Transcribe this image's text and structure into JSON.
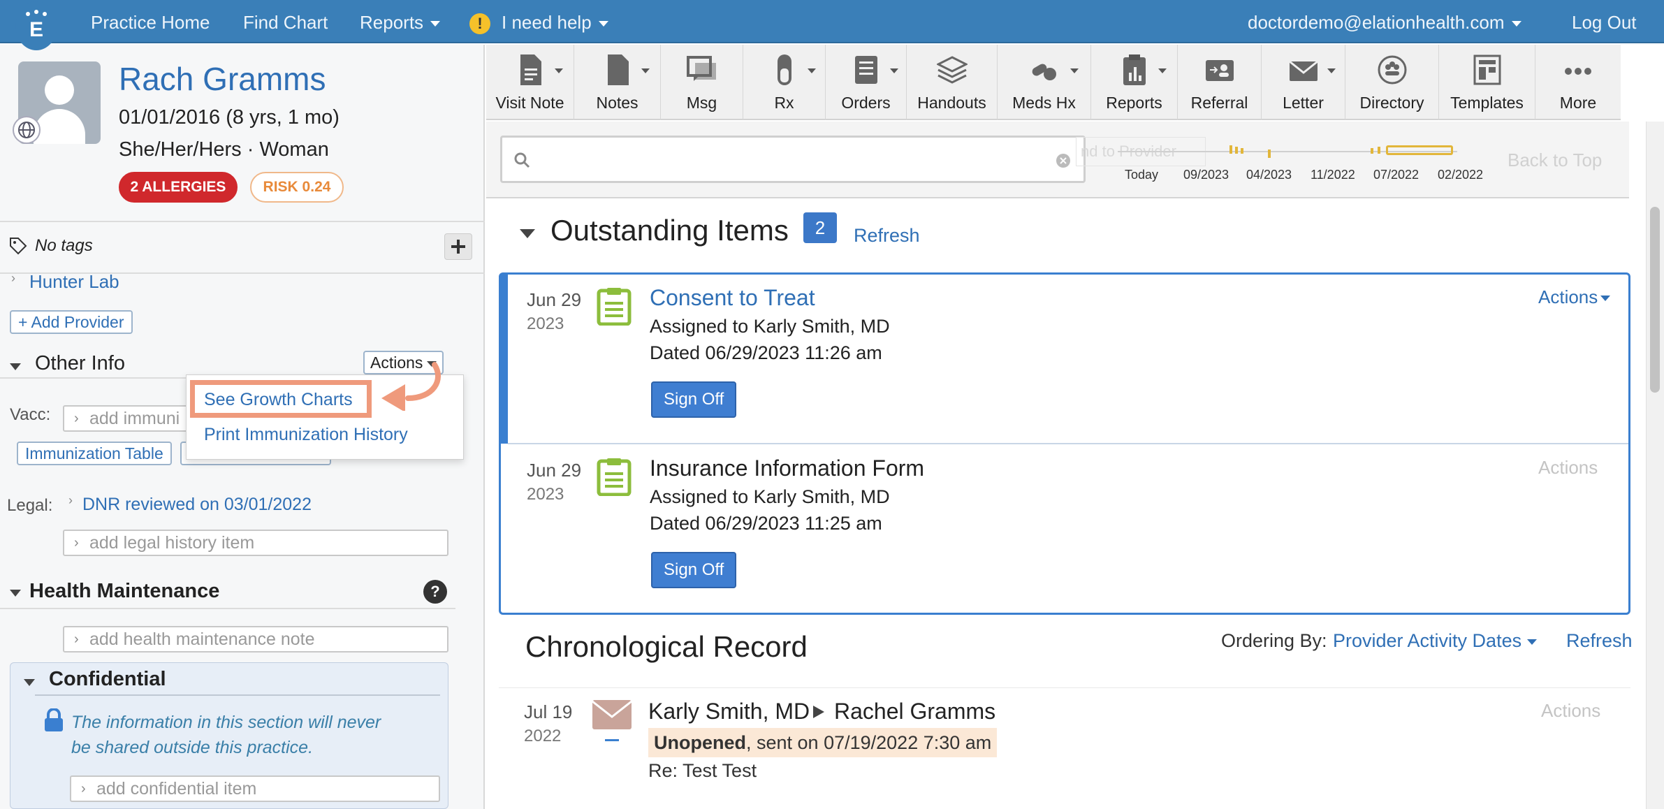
{
  "nav": {
    "practice_home": "Practice Home",
    "find_chart": "Find Chart",
    "reports": "Reports",
    "help": "I need help",
    "help_icon": "!",
    "user_email": "doctordemo@elationhealth.com",
    "logout": "Log Out"
  },
  "patient": {
    "name": "Rach Gramms",
    "dob": "01/01/2016 (8 yrs, 1 mo)",
    "pronouns": "She/Her/Hers · Woman",
    "allergies_badge": "2 ALLERGIES",
    "risk_badge": "RISK 0.24"
  },
  "left": {
    "tags": "No tags",
    "provider_link": "Hunter Lab",
    "add_provider": "+ Add Provider",
    "other_info_title": "Other Info",
    "actions_label": "Actions",
    "vacc_label": "Vacc:",
    "vacc_placeholder": "add immuni",
    "immunization_table": "Immunization Table",
    "legal_label": "Legal:",
    "dnr": "DNR reviewed on 03/01/2022",
    "legal_placeholder": "add legal history item",
    "health_maint_title": "Health Maintenance",
    "health_maint_help": "?",
    "health_placeholder": "add health maintenance note",
    "confidential_title": "Confidential",
    "confidential_note_line1": "The information in this section will never",
    "confidential_note_line2": "be shared outside this practice.",
    "confidential_placeholder": "add confidential item"
  },
  "dropdown": {
    "growth_charts": "See Growth Charts",
    "print_immunization": "Print Immunization History"
  },
  "toolbar": [
    {
      "label": "Visit Note"
    },
    {
      "label": "Notes"
    },
    {
      "label": "Msg"
    },
    {
      "label": "Rx"
    },
    {
      "label": "Orders"
    },
    {
      "label": "Handouts"
    },
    {
      "label": "Meds Hx"
    },
    {
      "label": "Reports"
    },
    {
      "label": "Referral"
    },
    {
      "label": "Letter"
    },
    {
      "label": "Directory"
    },
    {
      "label": "Templates"
    },
    {
      "label": "More"
    }
  ],
  "timeline": {
    "ghost_label": "nd to Provider",
    "labels": [
      "Today",
      "09/2023",
      "04/2023",
      "11/2022",
      "07/2022",
      "02/2022"
    ],
    "back_to_top": "Back to Top"
  },
  "outstanding": {
    "title": "Outstanding Items",
    "count": "2",
    "refresh": "Refresh",
    "items": [
      {
        "month_day": "Jun 29",
        "year": "2023",
        "title": "Consent to Treat",
        "assigned": "Assigned to Karly Smith, MD",
        "dated": "Dated 06/29/2023 11:26 am",
        "sign_off": "Sign Off",
        "actions": "Actions"
      },
      {
        "month_day": "Jun 29",
        "year": "2023",
        "title": "Insurance Information Form",
        "assigned": "Assigned to Karly Smith, MD",
        "dated": "Dated 06/29/2023 11:25 am",
        "sign_off": "Sign Off",
        "actions": "Actions"
      }
    ]
  },
  "chrono": {
    "title": "Chronological Record",
    "ordering_label": "Ordering By:",
    "ordering_value": "Provider Activity Dates",
    "refresh": "Refresh",
    "entry": {
      "month_day": "Jul 19",
      "year": "2022",
      "from": "Karly Smith, MD",
      "to": "Rachel Gramms",
      "status": "Unopened",
      "sent": ", sent on 07/19/2022 7:30 am",
      "re": "Re: Test Test",
      "actions": "Actions"
    }
  },
  "colors": {
    "nav": "#3a7fb8",
    "link": "#2f6fb5",
    "allergy": "#d0282c",
    "risk": "#e88a3a",
    "highlight": "#ef9a7c"
  }
}
